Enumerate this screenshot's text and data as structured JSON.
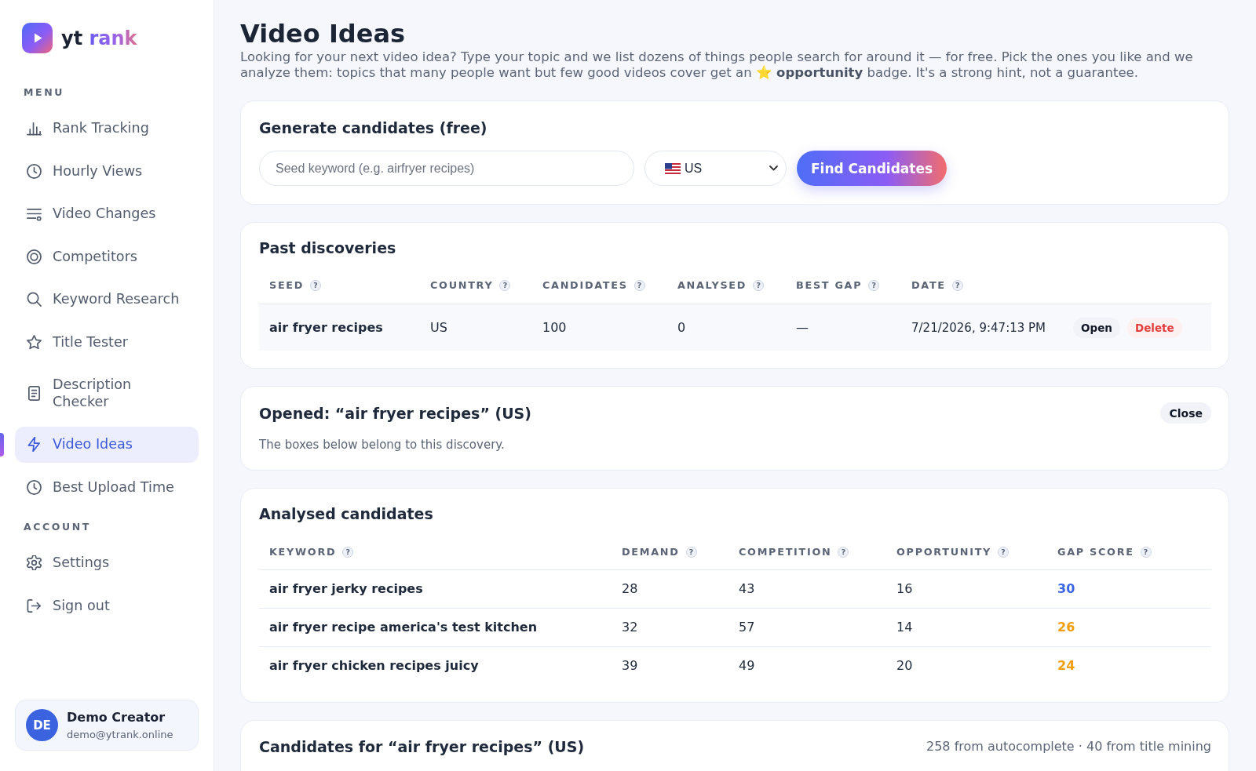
{
  "sidebar": {
    "brand": {
      "prefix": "yt",
      "name": "rank"
    },
    "sections": [
      {
        "title": "MENU",
        "items": [
          {
            "label": "Rank Tracking",
            "selected": false
          },
          {
            "label": "Hourly Views",
            "selected": false
          },
          {
            "label": "Video Changes",
            "selected": false
          },
          {
            "label": "Competitors",
            "selected": false
          },
          {
            "label": "Keyword Research",
            "selected": false
          },
          {
            "label": "Title Tester",
            "selected": false
          },
          {
            "label": "Description Checker",
            "selected": false
          },
          {
            "label": "Video Ideas",
            "selected": true
          },
          {
            "label": "Best Upload Time",
            "selected": false
          }
        ]
      },
      {
        "title": "ACCOUNT",
        "items": [
          {
            "label": "Settings",
            "selected": false
          },
          {
            "label": "Sign out",
            "selected": false
          }
        ]
      }
    ],
    "user": {
      "initials": "DE",
      "name": "Demo Creator",
      "email": "demo@ytrank.online"
    }
  },
  "page": {
    "title": "Video Ideas",
    "description": "Looking for your next video idea? Type your topic and we list dozens of things people search for around it — for free. Pick the ones you like and we analyze them: topics that many people want but few good videos cover get an ⭐ **opportunity** badge. It's a strong hint, not a guarantee."
  },
  "generate": {
    "title": "Generate candidates (free)",
    "seed_field": {
      "placeholder": "Seed keyword (e.g. airfryer recipes)"
    },
    "country_select": {
      "value": "US"
    },
    "button": "Find Candidates"
  },
  "past_discoveries": {
    "title": "Past discoveries",
    "columns": [
      {
        "label": "SEED",
        "help": "?"
      },
      {
        "label": "COUNTRY",
        "help": "?"
      },
      {
        "label": "CANDIDATES",
        "help": "?"
      },
      {
        "label": "ANALYSED",
        "help": "?"
      },
      {
        "label": "BEST GAP",
        "help": "?"
      },
      {
        "label": "DATE",
        "help": "?"
      }
    ],
    "rows": [
      {
        "cells": [
          "air fryer recipes",
          "US",
          "100",
          "0",
          "—",
          "7/21/2026, 9:47:13 PM"
        ],
        "actions": [
          {
            "label": "Open",
            "kind": "neutral"
          },
          {
            "label": "Delete",
            "kind": "danger"
          }
        ]
      }
    ]
  },
  "opened": {
    "title": "Opened: “air fryer recipes” (US)",
    "note": "The boxes below belong to this discovery.",
    "close_button": "Close"
  },
  "analysed": {
    "title": "Analysed candidates",
    "columns": [
      {
        "label": "KEYWORD",
        "help": "?"
      },
      {
        "label": "DEMAND",
        "help": "?"
      },
      {
        "label": "COMPETITION",
        "help": "?"
      },
      {
        "label": "OPPORTUNITY",
        "help": "?"
      },
      {
        "label": "GAP SCORE",
        "help": "?"
      }
    ],
    "rows": [
      {
        "cells": [
          "air fryer jerky recipes",
          "28",
          "43",
          "16"
        ],
        "gap_score": "30",
        "color": "#3b66e3"
      },
      {
        "cells": [
          "air fryer recipe america's test kitchen",
          "32",
          "57",
          "14"
        ],
        "gap_score": "26",
        "color": "#f29e0c"
      },
      {
        "cells": [
          "air fryer chicken recipes juicy",
          "39",
          "49",
          "20"
        ],
        "gap_score": "24",
        "color": "#f29e0c"
      }
    ]
  },
  "candidates": {
    "title": "Candidates for “air fryer recipes” (US)",
    "summary": "258 from autocomplete · 40 from title mining"
  }
}
